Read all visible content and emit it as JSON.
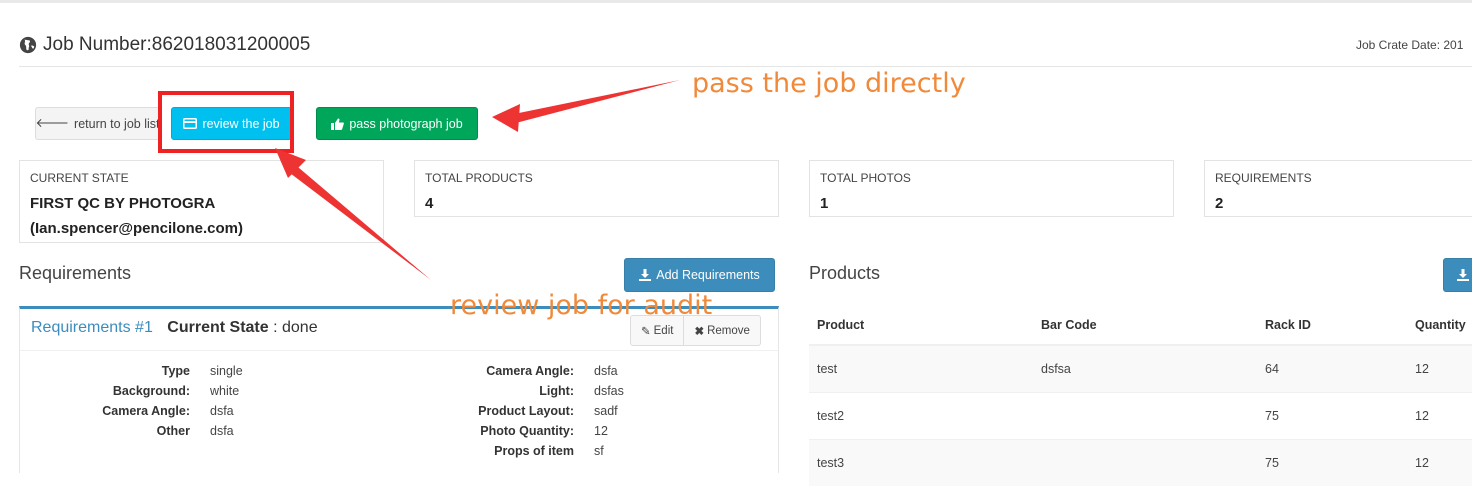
{
  "header": {
    "title": "Job Number:862018031200005",
    "crate_date": "Job Crate Date: 201"
  },
  "toolbar": {
    "return_label": "return to job list",
    "review_label": "review the job",
    "pass_label": "pass photograph job"
  },
  "annotations": {
    "pass_note": "pass the job directly",
    "review_note": "review job for audit",
    "highlight_color": "#ee2222",
    "note_color": "#f08a3a"
  },
  "stats": {
    "state_label": "CURRENT STATE",
    "state_value_line1": "FIRST QC BY PHOTOGRA",
    "state_value_line2": "(Ian.spencer@pencilone.com)",
    "products_label": "TOTAL PRODUCTS",
    "products_value": "4",
    "photos_label": "TOTAL PHOTOS",
    "photos_value": "1",
    "requirements_label": "REQUIREMENTS",
    "requirements_value": "2"
  },
  "requirements": {
    "section_title": "Requirements",
    "add_label": "Add Requirements",
    "item": {
      "title": "Requirements #1",
      "state_label": "Current State",
      "state_value": " : done",
      "edit_label": "Edit",
      "remove_label": "Remove",
      "left": [
        {
          "key": "Type",
          "value": "single"
        },
        {
          "key": "Background:",
          "value": "white"
        },
        {
          "key": "Camera Angle:",
          "value": "dsfa"
        },
        {
          "key": "Other",
          "value": "dsfa"
        }
      ],
      "right": [
        {
          "key": "Camera Angle:",
          "value": "dsfa"
        },
        {
          "key": "Light:",
          "value": "dsfas"
        },
        {
          "key": "Product Layout:",
          "value": "sadf"
        },
        {
          "key": "Photo Quantity:",
          "value": "12"
        },
        {
          "key": "Props of item",
          "value": "sf"
        }
      ]
    }
  },
  "products": {
    "section_title": "Products",
    "columns": [
      "Product",
      "Bar Code",
      "Rack ID",
      "Quantity"
    ],
    "rows": [
      [
        "test",
        "dsfsa",
        "64",
        "12"
      ],
      [
        "test2",
        "",
        "75",
        "12"
      ],
      [
        "test3",
        "",
        "75",
        "12"
      ]
    ]
  },
  "colors": {
    "primary": "#3c8dbc",
    "info": "#00c0ef",
    "success": "#00a65a"
  }
}
